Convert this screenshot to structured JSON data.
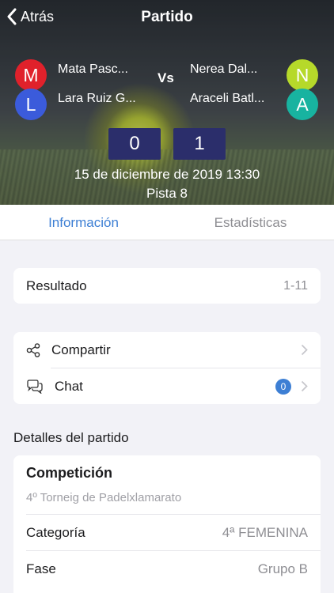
{
  "nav": {
    "back_label": "Atrás",
    "title": "Partido"
  },
  "match": {
    "team1": [
      {
        "initial": "M",
        "name": "Mata Pasc...",
        "color": "#e0212b"
      },
      {
        "initial": "L",
        "name": "Lara Ruiz G...",
        "color": "#3b5bdb"
      }
    ],
    "team2": [
      {
        "initial": "N",
        "name": "Nerea Dal...",
        "color": "#b6d92a"
      },
      {
        "initial": "A",
        "name": "Araceli Batl...",
        "color": "#18b3a0"
      }
    ],
    "vs_label": "Vs",
    "score1": "0",
    "score2": "1",
    "datetime": "15 de diciembre de 2019 13:30",
    "court": "Pista 8"
  },
  "tabs": [
    {
      "label": "Información",
      "active": true
    },
    {
      "label": "Estadísticas",
      "active": false
    }
  ],
  "result": {
    "label": "Resultado",
    "value": "1-11"
  },
  "actions": {
    "share_label": "Compartir",
    "chat_label": "Chat",
    "chat_count": "0"
  },
  "details": {
    "section_title": "Detalles del partido",
    "competition_label": "Competición",
    "competition_value": "4º Torneig de Padelxlamarato",
    "category_label": "Categoría",
    "category_value": "4ª FEMENINA",
    "phase_label": "Fase",
    "phase_value": "Grupo B"
  },
  "colors": {
    "accent": "#3d7fd4",
    "score_bg": "#2b2e6b"
  }
}
